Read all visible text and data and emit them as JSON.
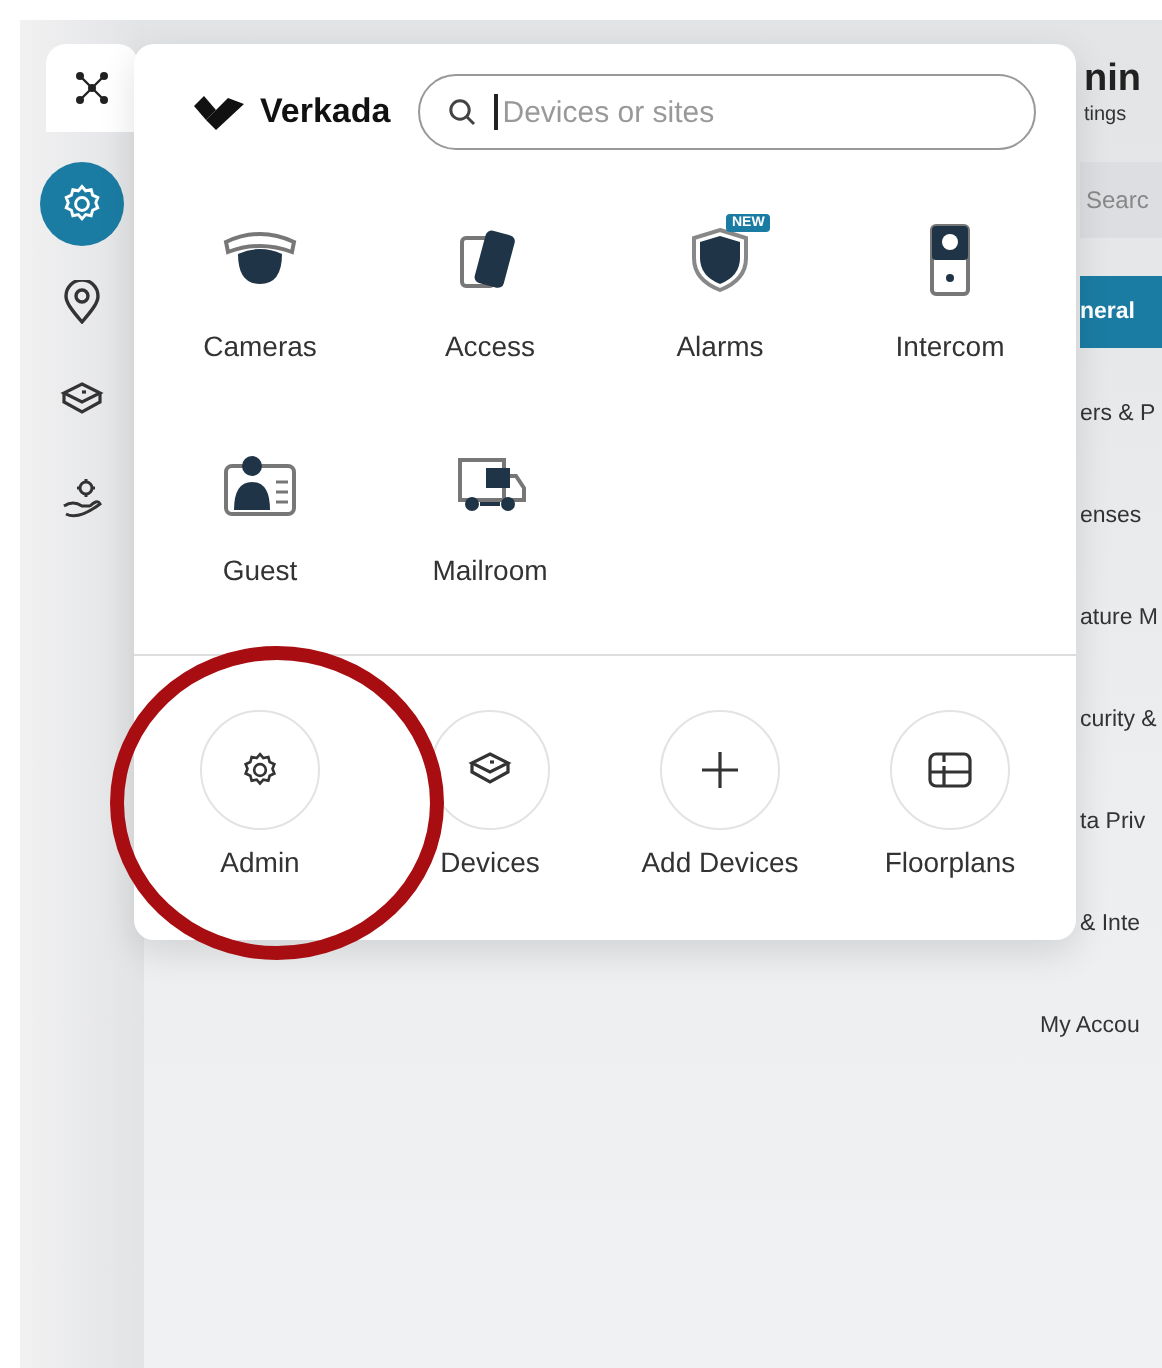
{
  "sidebar": {
    "items": [
      {
        "kind": "launcher",
        "selected": false
      },
      {
        "kind": "settings",
        "selected": true
      },
      {
        "kind": "location",
        "selected": false
      },
      {
        "kind": "devices",
        "selected": false
      },
      {
        "kind": "support",
        "selected": false
      }
    ]
  },
  "menu": {
    "brand": "Verkada",
    "search": {
      "placeholder": "Devices or sites"
    },
    "apps": [
      {
        "kind": "camera",
        "label": "Cameras"
      },
      {
        "kind": "access",
        "label": "Access"
      },
      {
        "kind": "alarm",
        "label": "Alarms",
        "badge": "NEW"
      },
      {
        "kind": "intercom",
        "label": "Intercom"
      },
      {
        "kind": "guest",
        "label": "Guest"
      },
      {
        "kind": "mailroom",
        "label": "Mailroom"
      }
    ],
    "shortcuts": [
      {
        "kind": "admin",
        "label": "Admin"
      },
      {
        "kind": "devices",
        "label": "Devices"
      },
      {
        "kind": "add",
        "label": "Add Devices"
      },
      {
        "kind": "floorplan",
        "label": "Floorplans"
      }
    ]
  },
  "admin_panel": {
    "title": "nin",
    "subtitle": "tings",
    "search": {
      "placeholder": "Searc"
    },
    "items": [
      {
        "label": "neral",
        "selected": true
      },
      {
        "label": "ers & P",
        "selected": false
      },
      {
        "label": "enses",
        "selected": false
      },
      {
        "label": "ature M",
        "selected": false
      },
      {
        "label": "curity &",
        "selected": false
      },
      {
        "label": "ta Priv",
        "selected": false
      },
      {
        "label": "& Inte",
        "selected": false
      },
      {
        "label": "My Accou",
        "selected": false
      }
    ]
  }
}
